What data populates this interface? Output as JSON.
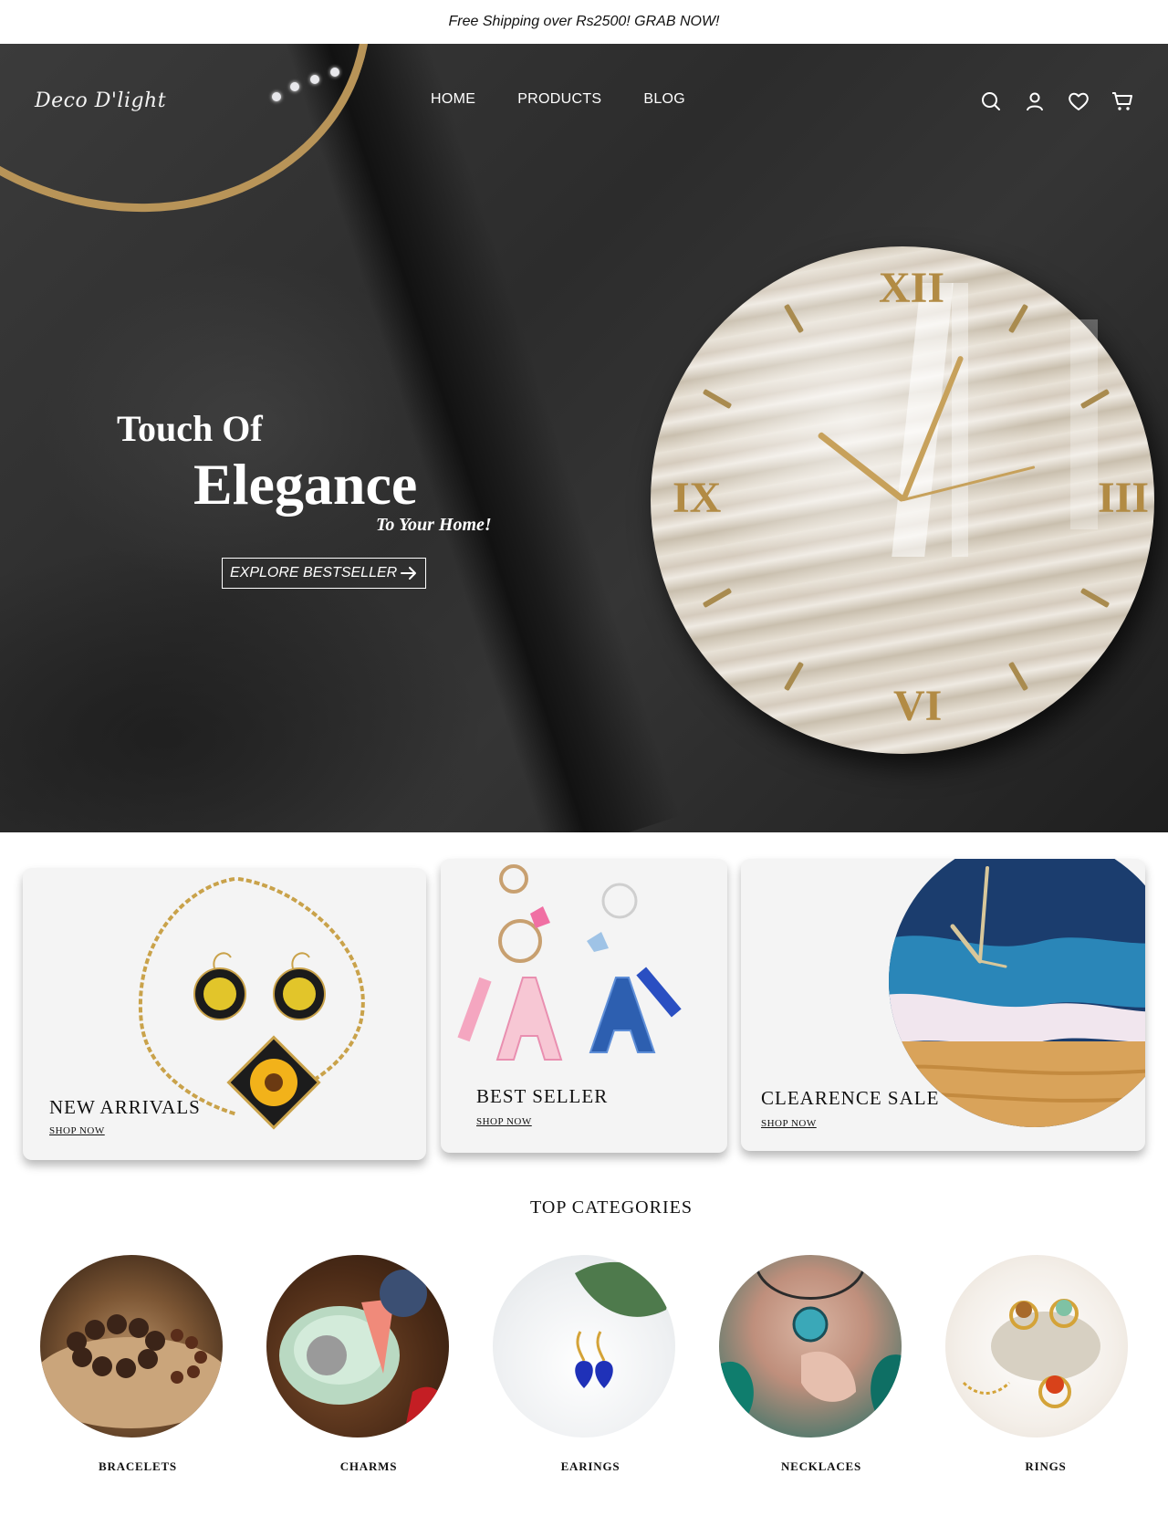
{
  "announcement": {
    "text": "Free Shipping over Rs2500!  GRAB NOW!"
  },
  "header": {
    "logo": "Deco D'light",
    "nav": [
      "HOME",
      "PRODUCTS",
      "BLOG"
    ],
    "icons": [
      "search-icon",
      "account-icon",
      "heart-icon",
      "cart-icon"
    ]
  },
  "hero": {
    "line1": "Touch Of",
    "line2": "Elegance",
    "line3": "To Your Home!",
    "cta": "EXPLORE BESTSELLER",
    "clock_numerals": [
      "XII",
      "III",
      "VI",
      "IX"
    ]
  },
  "promos": [
    {
      "title": "NEW ARRIVALS",
      "link": "SHOP NOW"
    },
    {
      "title": "BEST SELLER",
      "link": "SHOP NOW"
    },
    {
      "title": "CLEARENCE SALE",
      "link": "SHOP NOW"
    }
  ],
  "categories": {
    "title": "TOP CATEGORIES",
    "items": [
      "BRACELETS",
      "CHARMS",
      "EARINGS",
      "NECKLACES",
      "RINGS"
    ]
  },
  "colors": {
    "gold": "#c7a15b",
    "hero_bg": "#2e2e2e",
    "card_bg": "#f4f4f4"
  }
}
